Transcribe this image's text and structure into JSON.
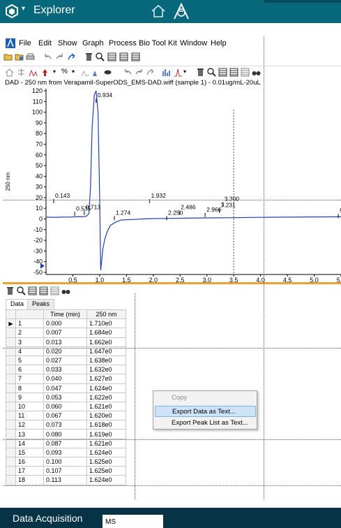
{
  "explorer": {
    "title": "Explorer",
    "caret": "▾"
  },
  "menu": [
    "File",
    "Edit",
    "Show",
    "Graph",
    "Process",
    "Bio Tool Kit",
    "Window",
    "Help"
  ],
  "graph": {
    "title": "DAD - 250 nm from Verapamil-SuperODS_EMS-DAD.wiff (sample 1) - 0.01ug/mL-20uL",
    "ylabel": "250 nm"
  },
  "chart_data": {
    "type": "line",
    "title": "DAD - 250 nm from Verapamil-SuperODS_EMS-DAD.wiff (sample 1) - 0.01ug/mL-20uL",
    "xlabel": "",
    "ylabel": "250 nm",
    "xlim": [
      0.0,
      5.5
    ],
    "ylim": [
      -52,
      122
    ],
    "xticks": [
      0.5,
      1.0,
      1.5,
      2.0,
      2.5,
      3.0,
      3.5,
      4.0,
      4.5,
      5.0
    ],
    "xtick_labels": [
      "0.5",
      "1.0",
      "1.5",
      "2.0",
      "2.5",
      "3.0",
      "3.5",
      "4.0",
      "4.5",
      "5.0",
      "5.5"
    ],
    "yticks": [
      -50,
      -40,
      -30,
      -20,
      -10,
      0,
      10,
      20,
      30,
      40,
      50,
      60,
      70,
      80,
      90,
      100,
      110,
      120
    ],
    "series": [
      {
        "x": [
          0.0,
          0.1,
          0.2,
          0.3,
          0.4,
          0.5,
          0.55,
          0.6,
          0.65,
          0.7,
          0.75,
          0.8,
          0.83,
          0.86,
          0.9,
          0.934,
          0.97,
          1.0,
          1.02,
          1.04,
          1.06,
          1.1,
          1.15,
          1.2,
          1.3,
          1.4,
          1.6,
          1.8,
          2.0,
          2.3,
          2.6,
          3.0,
          3.5,
          4.0,
          4.5,
          5.0,
          5.5
        ],
        "y": [
          1.7,
          1.6,
          1.6,
          1.7,
          1.8,
          1.9,
          2.1,
          2.2,
          2.0,
          2.2,
          2.5,
          5,
          30,
          85,
          116,
          120,
          100,
          20,
          -48,
          -38,
          -28,
          -18,
          -11,
          -6,
          -3,
          -1,
          -0.5,
          0,
          0.3,
          0.5,
          0.7,
          1.0,
          1.2,
          1.5,
          1.7,
          1.9,
          2.0
        ]
      }
    ],
    "peak_labels": [
      {
        "x": 0.143,
        "y": 20,
        "label": "0.143"
      },
      {
        "x": 0.535,
        "y": 8,
        "label": "0.535"
      },
      {
        "x": 0.713,
        "y": 9,
        "label": "0.713"
      },
      {
        "x": 0.934,
        "y": 114,
        "label": "0.934"
      },
      {
        "x": 1.274,
        "y": 4,
        "label": "1.274"
      },
      {
        "x": 1.932,
        "y": 20,
        "label": "1.932"
      },
      {
        "x": 2.25,
        "y": 4,
        "label": "2.250"
      },
      {
        "x": 2.486,
        "y": 9,
        "label": "2.486"
      },
      {
        "x": 2.966,
        "y": 7,
        "label": "2.966"
      },
      {
        "x": 3.231,
        "y": 11,
        "label": "3.231"
      },
      {
        "x": 3.3,
        "y": 17,
        "label": "3.300"
      },
      {
        "x": 5.45,
        "y": 6,
        "label": "5.5"
      }
    ],
    "cursor_x": 3.5
  },
  "datapane": {
    "tabs": [
      "Data",
      "Peaks"
    ],
    "headers": [
      "",
      "Time (min)",
      "250 nm"
    ],
    "rows": [
      [
        "1",
        "0.000",
        "1.710e0"
      ],
      [
        "2",
        "0.007",
        "1.684e0"
      ],
      [
        "3",
        "0.013",
        "1.662e0"
      ],
      [
        "4",
        "0.020",
        "1.647e0"
      ],
      [
        "5",
        "0.027",
        "1.638e0"
      ],
      [
        "6",
        "0.033",
        "1.632e0"
      ],
      [
        "7",
        "0.040",
        "1.627e0"
      ],
      [
        "8",
        "0.047",
        "1.624e0"
      ],
      [
        "9",
        "0.053",
        "1.622e0"
      ],
      [
        "10",
        "0.060",
        "1.621e0"
      ],
      [
        "11",
        "0.067",
        "1.620e0"
      ],
      [
        "12",
        "0.073",
        "1.618e0"
      ],
      [
        "13",
        "0.080",
        "1.619e0"
      ],
      [
        "14",
        "0.087",
        "1.621e0"
      ],
      [
        "15",
        "0.093",
        "1.624e0"
      ],
      [
        "16",
        "0.100",
        "1.625e0"
      ],
      [
        "17",
        "0.107",
        "1.625e0"
      ],
      [
        "18",
        "0.113",
        "1.624e0"
      ]
    ]
  },
  "context_menu": {
    "copy": "Copy",
    "export_data": "Export Data as Text...",
    "export_peaks": "Export Peak List as Text..."
  },
  "bottom": {
    "title": "Data Acquisition",
    "ms": "MS"
  },
  "colors": {
    "teal": "#07677b",
    "dark": "#063446",
    "trace": "#1f3fb0",
    "splitter": "#f0a030"
  }
}
